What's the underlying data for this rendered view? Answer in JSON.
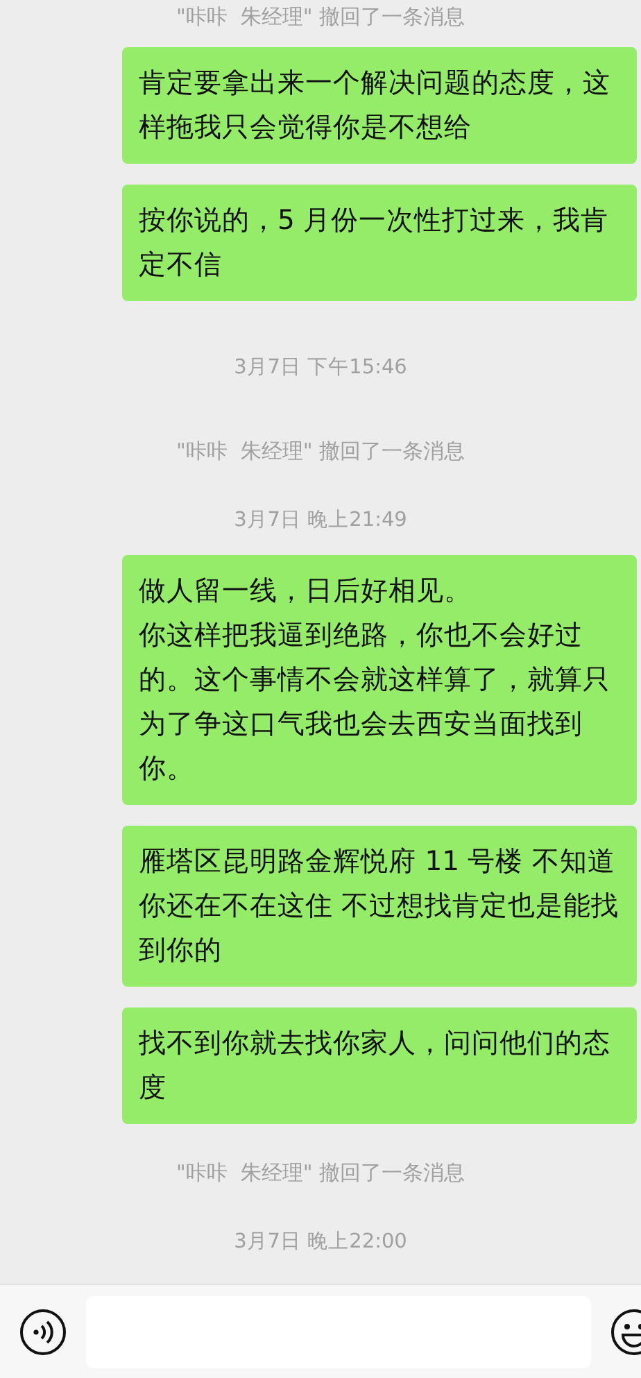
{
  "messages": [
    {
      "kind": "notice",
      "text": "\"咔咔  朱经理\" 撤回了一条消息"
    },
    {
      "kind": "outgoing",
      "text": "肯定要拿出来一个解决问题的态度，这样拖我只会觉得你是不想给"
    },
    {
      "kind": "outgoing",
      "text": "按你说的，5 月份一次性打过来，我肯定不信"
    },
    {
      "kind": "time",
      "text": "3月7日 下午15:46"
    },
    {
      "kind": "notice",
      "text": "\"咔咔  朱经理\" 撤回了一条消息"
    },
    {
      "kind": "time",
      "text": "3月7日 晚上21:49"
    },
    {
      "kind": "outgoing",
      "text": "做人留一线，日后好相见。"
    },
    {
      "kind": "continuation",
      "text": "你这样把我逼到绝路，你也不会好过的。这个事情不会就这样算了，就算只为了争这口气我也会去西安当面找到你。"
    },
    {
      "kind": "outgoing",
      "text": "雁塔区昆明路金辉悦府 11 号楼  不知道你还在不在这住 不过想找肯定也是能找到你的"
    },
    {
      "kind": "outgoing",
      "text": "找不到你就去找你家人，问问他们的态度"
    },
    {
      "kind": "notice",
      "text": "\"咔咔  朱经理\" 撤回了一条消息"
    },
    {
      "kind": "time",
      "text": "3月7日 晚上22:00"
    }
  ]
}
